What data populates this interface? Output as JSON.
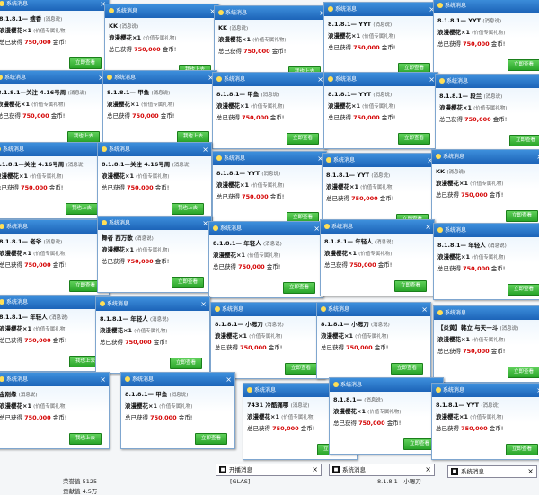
{
  "popup_title": "系统消息",
  "popups": [
    {
      "title": "系统消息",
      "l1": "8.1.8.1—",
      "l1b": "嫂香",
      "l1s": "(消息说)",
      "l2": "浪漫樱花",
      "l2b": "×1",
      "l2s": "(价值专属礼物)",
      "l3": "总已获得",
      "amt": "750,000",
      "unit": "金币!",
      "btn": "立即查看"
    },
    {
      "title": "系统消息",
      "l1": "KK",
      "l1b": "",
      "l1s": "(消息说)",
      "l2": "浪漫樱花",
      "l2b": "×1",
      "l2s": "(价值专属礼物)",
      "l3": "总已获得",
      "amt": "750,000",
      "unit": "金币!",
      "btn": "我也上去"
    },
    {
      "title": "系统消息",
      "l1": "KK",
      "l1b": "",
      "l1s": "(消息说)",
      "l2": "浪漫樱花",
      "l2b": "×1",
      "l2s": "(价值专属礼物)",
      "l3": "总已获得",
      "amt": "750,000",
      "unit": "金币!",
      "btn": "我也上去"
    },
    {
      "title": "系统消息",
      "l1": "8.1.8.1—",
      "l1b": "YYT",
      "l1s": "(消息说)",
      "l2": "浪漫樱花",
      "l2b": "×1",
      "l2s": "(价值专属礼物)",
      "l3": "总已获得",
      "amt": "750,000",
      "unit": "金币!",
      "btn": "立即查看"
    },
    {
      "title": "系统消息",
      "l1": "8.1.8.1—",
      "l1b": "YYT",
      "l1s": "(消息说)",
      "l2": "浪漫樱花",
      "l2b": "×1",
      "l2s": "(价值专属礼物)",
      "l3": "总已获得",
      "amt": "750,000",
      "unit": "金币!",
      "btn": "立即查看"
    },
    {
      "title": "系统消息",
      "l1": "8.1.8.1—关注",
      "l1b": "4.16号周",
      "l1s": "(消息说)",
      "l2": "浪漫樱花",
      "l2b": "×1",
      "l2s": "(价值专属礼物)",
      "l3": "总已获得",
      "amt": "750,000",
      "unit": "金币!",
      "btn": "我也上去"
    },
    {
      "title": "系统消息",
      "l1": "8.1.8.1—",
      "l1b": "甲鱼",
      "l1s": "(消息说)",
      "l2": "浪漫樱花",
      "l2b": "×1",
      "l2s": "(价值专属礼物)",
      "l3": "总已获得",
      "amt": "750,000",
      "unit": "金币!",
      "btn": "我也上去"
    },
    {
      "title": "系统消息",
      "l1": "8.1.8.1—",
      "l1b": "甲鱼",
      "l1s": "(消息说)",
      "l2": "浪漫樱花",
      "l2b": "×1",
      "l2s": "(价值专属礼物)",
      "l3": "总已获得",
      "amt": "750,000",
      "unit": "金币!",
      "btn": "立即查看"
    },
    {
      "title": "系统消息",
      "l1": "8.1.8.1—",
      "l1b": "YYT",
      "l1s": "(消息说)",
      "l2": "浪漫樱花",
      "l2b": "×1",
      "l2s": "(价值专属礼物)",
      "l3": "总已获得",
      "amt": "750,000",
      "unit": "金币!",
      "btn": "立即查看"
    },
    {
      "title": "系统消息",
      "l1": "8.1.8.1—",
      "l1b": "段兰",
      "l1s": "(消息说)",
      "l2": "浪漫樱花",
      "l2b": "×1",
      "l2s": "(价值专属礼物)",
      "l3": "总已获得",
      "amt": "750,000",
      "unit": "金币!",
      "btn": "立即查看"
    },
    {
      "title": "系统消息",
      "l1": "8.1.8.1—关注",
      "l1b": "4.16号周",
      "l1s": "(消息说)",
      "l2": "浪漫樱花",
      "l2b": "×1",
      "l2s": "(价值专属礼物)",
      "l3": "总已获得",
      "amt": "750,000",
      "unit": "金币!",
      "btn": "我也上去"
    },
    {
      "title": "系统消息",
      "l1": "8.1.8.1—关注",
      "l1b": "4.16号周",
      "l1s": "(消息说)",
      "l2": "浪漫樱花",
      "l2b": "×1",
      "l2s": "(价值专属礼物)",
      "l3": "总已获得",
      "amt": "750,000",
      "unit": "金币!",
      "btn": "我也上去"
    },
    {
      "title": "系统消息",
      "l1": "8.1.8.1—",
      "l1b": "YYT",
      "l1s": "(消息说)",
      "l2": "浪漫樱花",
      "l2b": "×1",
      "l2s": "(价值专属礼物)",
      "l3": "总已获得",
      "amt": "750,000",
      "unit": "金币!",
      "btn": "立即查看"
    },
    {
      "title": "系统消息",
      "l1": "8.1.8.1—",
      "l1b": "YYT",
      "l1s": "(消息说)",
      "l2": "浪漫樱花",
      "l2b": "×1",
      "l2s": "(价值专属礼物)",
      "l3": "总已获得",
      "amt": "750,000",
      "unit": "金币!",
      "btn": "立即查看"
    },
    {
      "title": "系统消息",
      "l1": "KK",
      "l1b": "",
      "l1s": "(消息说)",
      "l2": "浪漫樱花",
      "l2b": "×1",
      "l2s": "(价值专属礼物)",
      "l3": "总已获得",
      "amt": "750,000",
      "unit": "金币!",
      "btn": "立即查看"
    },
    {
      "title": "系统消息",
      "l1": "8.1.8.1—",
      "l1b": "老爷",
      "l1s": "(消息说)",
      "l2": "浪漫樱花",
      "l2b": "×1",
      "l2s": "(价值专属礼物)",
      "l3": "总已获得",
      "amt": "750,000",
      "unit": "金币!",
      "btn": "立即查看"
    },
    {
      "title": "系统消息",
      "l1": "舞者",
      "l1b": "西万歌",
      "l1s": "(消息说)",
      "l2": "浪漫樱花",
      "l2b": "×1",
      "l2s": "(价值专属礼物)",
      "l3": "总已获得",
      "amt": "750,000",
      "unit": "金币!",
      "btn": "立即查看"
    },
    {
      "title": "系统消息",
      "l1": "8.1.8.1—",
      "l1b": "年轻人",
      "l1s": "(消息说)",
      "l2": "浪漫樱花",
      "l2b": "×1",
      "l2s": "(价值专属礼物)",
      "l3": "总已获得",
      "amt": "750,000",
      "unit": "金币!",
      "btn": "立即查看"
    },
    {
      "title": "系统消息",
      "l1": "8.1.8.1—",
      "l1b": "年轻人",
      "l1s": "(消息说)",
      "l2": "浪漫樱花",
      "l2b": "×1",
      "l2s": "(价值专属礼物)",
      "l3": "总已获得",
      "amt": "750,000",
      "unit": "金币!",
      "btn": "立即查看"
    },
    {
      "title": "系统消息",
      "l1": "8.1.8.1—",
      "l1b": "年轻人",
      "l1s": "(消息说)",
      "l2": "浪漫樱花",
      "l2b": "×1",
      "l2s": "(价值专属礼物)",
      "l3": "总已获得",
      "amt": "750,000",
      "unit": "金币!",
      "btn": "立即查看"
    },
    {
      "title": "系统消息",
      "l1": "8.1.8.1—",
      "l1b": "年轻人",
      "l1s": "(消息说)",
      "l2": "浪漫樱花",
      "l2b": "×1",
      "l2s": "(价值专属礼物)",
      "l3": "总已获得",
      "amt": "750,000",
      "unit": "金币!",
      "btn": "我也上去"
    },
    {
      "title": "系统消息",
      "l1": "8.1.8.1—",
      "l1b": "年轻人",
      "l1s": "(消息说)",
      "l2": "浪漫樱花",
      "l2b": "×1",
      "l2s": "(价值专属礼物)",
      "l3": "总已获得",
      "amt": "750,000",
      "unit": "金币!",
      "btn": "立即查看"
    },
    {
      "title": "系统消息",
      "l1": "8.1.8.1—",
      "l1b": "小嗯刀",
      "l1s": "(消息说)",
      "l2": "浪漫樱花",
      "l2b": "×1",
      "l2s": "(价值专属礼物)",
      "l3": "总已获得",
      "amt": "750,000",
      "unit": "金币!",
      "btn": "立即查看"
    },
    {
      "title": "系统消息",
      "l1": "8.1.8.1—",
      "l1b": "小嗯刀",
      "l1s": "(消息说)",
      "l2": "浪漫樱花",
      "l2b": "×1",
      "l2s": "(价值专属礼物)",
      "l3": "总已获得",
      "amt": "750,000",
      "unit": "金币!",
      "btn": "立即查看"
    },
    {
      "title": "系统消息",
      "l1": "【炎黄】韩立",
      "l1b": "与天一斗",
      "l1s": "(消息说)",
      "l2": "浪漫樱花",
      "l2b": "×1",
      "l2s": "(价值专属礼物)",
      "l3": "总已获得",
      "amt": "750,000",
      "unit": "金币!",
      "btn": "立即查看"
    },
    {
      "title": "系统消息",
      "l1": "金刚缘",
      "l1b": "",
      "l1s": "(消息说)",
      "l2": "浪漫樱花",
      "l2b": "×1",
      "l2s": "(价值专属礼物)",
      "l3": "总已获得",
      "amt": "750,000",
      "unit": "金币!",
      "btn": "我也上去"
    },
    {
      "title": "系统消息",
      "l1": "8.1.8.1—",
      "l1b": "甲鱼",
      "l1s": "(消息说)",
      "l2": "浪漫樱花",
      "l2b": "×1",
      "l2s": "(价值专属礼物)",
      "l3": "总已获得",
      "amt": "750,000",
      "unit": "金币!",
      "btn": "立即查看"
    },
    {
      "title": "系统消息",
      "l1": "7431",
      "l1b": "冷酷痛哪",
      "l1s": "(消息说)",
      "l2": "浪漫樱花",
      "l2b": "×1",
      "l2s": "(价值专属礼物)",
      "l3": "总已获得",
      "amt": "750,000",
      "unit": "金币!",
      "btn": "立即查看"
    },
    {
      "title": "系统消息",
      "l1": "8.1.8.1—",
      "l1b": "",
      "l1s": "(消息说)",
      "l2": "浪漫樱花",
      "l2b": "×1",
      "l2s": "(价值专属礼物)",
      "l3": "总已获得",
      "amt": "750,000",
      "unit": "金币!",
      "btn": "立即查看"
    },
    {
      "title": "系统消息",
      "l1": "8.1.8.1—",
      "l1b": "YYT",
      "l1s": "(消息说)",
      "l2": "浪漫樱花",
      "l2b": "×1",
      "l2s": "(价值专属礼物)",
      "l3": "总已获得",
      "amt": "750,000",
      "unit": "金币!",
      "btn": "立即查看"
    }
  ],
  "bottom_bars": [
    {
      "label": "开播消息"
    },
    {
      "label": "系统消息"
    },
    {
      "label": "系统消息"
    }
  ],
  "fragments": {
    "glass": "[GLAS]",
    "mid": "8.1.8.1—小嗯刀",
    "left": "荣誉值 5125",
    "left2": "贡献值 4.5万"
  }
}
